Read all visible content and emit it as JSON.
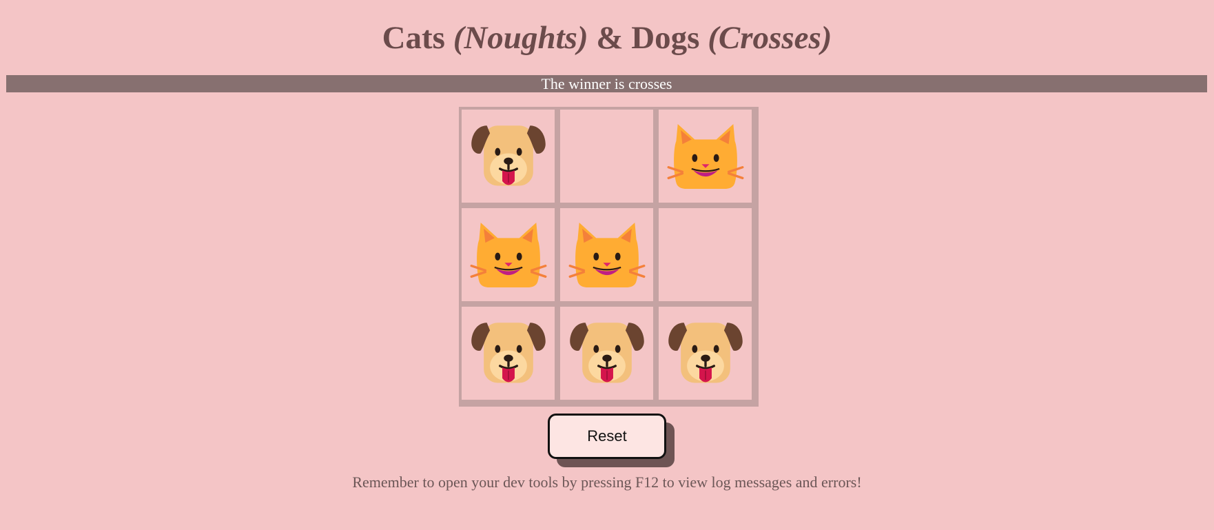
{
  "header": {
    "title_cats": "Cats ",
    "title_noughts": "(Noughts)",
    "title_amp": " & Dogs ",
    "title_crosses": "(Crosses)"
  },
  "status": {
    "text": "The winner is crosses"
  },
  "board": {
    "cells": [
      "dog",
      "",
      "cat",
      "cat",
      "cat",
      "",
      "dog",
      "dog",
      "dog"
    ]
  },
  "controls": {
    "reset_label": "Reset"
  },
  "footer": {
    "hint": "Remember to open your dev tools by pressing F12 to view log messages and errors!"
  },
  "colors": {
    "background": "#f4c5c6",
    "status_bar": "#877070",
    "title_text": "#6b4b4b",
    "grid_border": "#c5a3a3",
    "reset_bg": "#fde5e3",
    "reset_shadow": "#6e5454"
  },
  "icons": {
    "dog": "dog-face-icon",
    "cat": "cat-face-icon"
  }
}
